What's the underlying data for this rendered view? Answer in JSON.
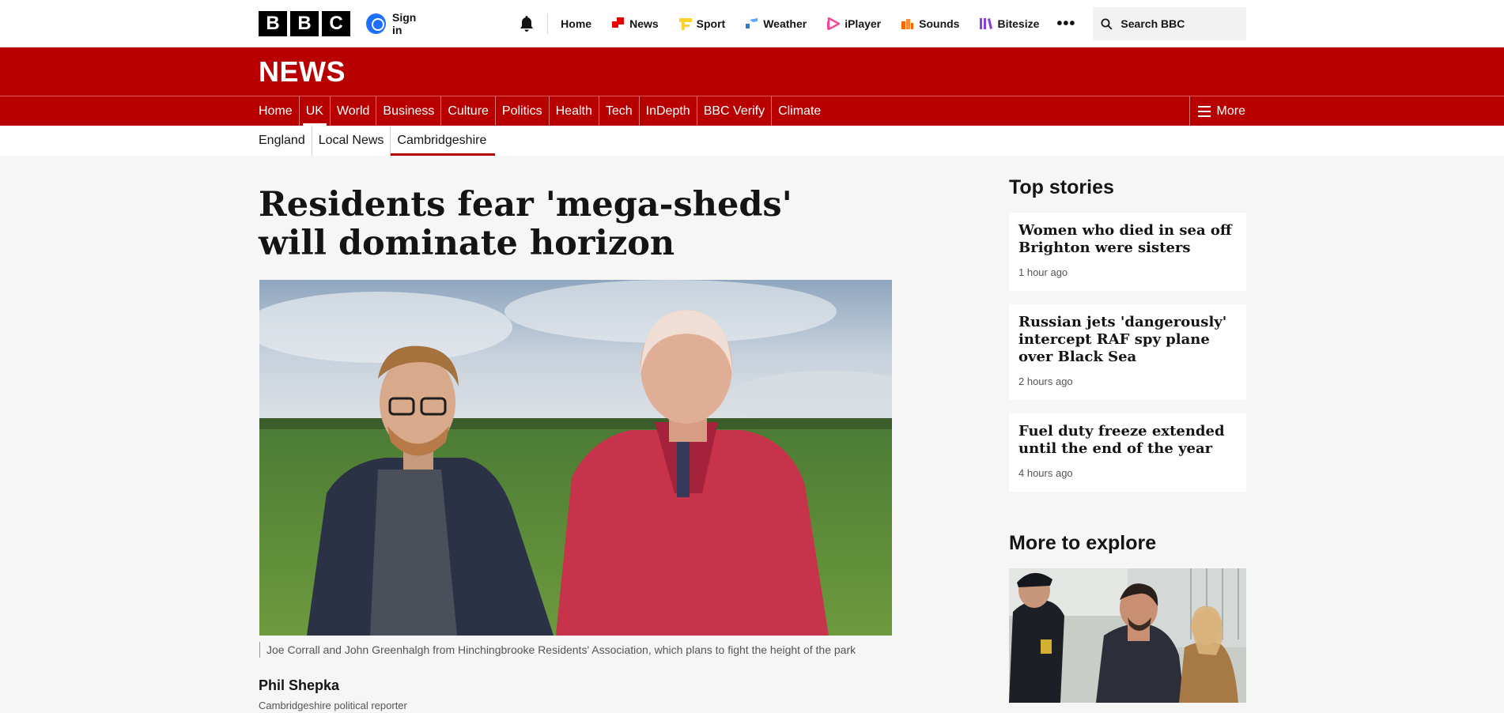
{
  "global": {
    "logo_letters": [
      "B",
      "B",
      "C"
    ],
    "signin": "Sign in",
    "nav": [
      {
        "label": "Home",
        "icon": "none"
      },
      {
        "label": "News",
        "icon": "news-icon",
        "color": "#e60000"
      },
      {
        "label": "Sport",
        "icon": "sport-icon",
        "color": "#ffd230"
      },
      {
        "label": "Weather",
        "icon": "weather-icon",
        "color": "#2c7ad6"
      },
      {
        "label": "iPlayer",
        "icon": "iplayer-icon",
        "color": "#f54997"
      },
      {
        "label": "Sounds",
        "icon": "sounds-icon",
        "color": "#ff6600"
      },
      {
        "label": "Bitesize",
        "icon": "bitesize-icon",
        "color": "#8a3ee0"
      }
    ],
    "more_label": "•••",
    "search_placeholder": "Search BBC"
  },
  "news_title": "NEWS",
  "section_nav": {
    "items": [
      "Home",
      "UK",
      "World",
      "Business",
      "Culture",
      "Politics",
      "Health",
      "Tech",
      "InDepth",
      "BBC Verify",
      "Climate"
    ],
    "active": "UK",
    "more": "More"
  },
  "sub_nav": {
    "items": [
      "England",
      "Local News",
      "Cambridgeshire"
    ],
    "active": "Cambridgeshire"
  },
  "article": {
    "headline": "Residents fear 'mega-sheds' will dominate horizon",
    "caption": "Joe Corrall and John Greenhalgh from Hinchingbrooke Residents' Association, which plans to fight the height of the park",
    "author": "Phil Shepka",
    "role": "Cambridgeshire political reporter"
  },
  "sidebar": {
    "top_stories_title": "Top stories",
    "stories": [
      {
        "title": "Women who died in sea off Brighton were sisters",
        "time": "1 hour ago"
      },
      {
        "title": "Russian jets 'dangerously' intercept RAF spy plane over Black Sea",
        "time": "2 hours ago"
      },
      {
        "title": "Fuel duty freeze extended until the end of the year",
        "time": "4 hours ago"
      }
    ],
    "explore_title": "More to explore"
  },
  "colors": {
    "brand_red": "#b80000",
    "page_bg": "#f6f6f6"
  }
}
